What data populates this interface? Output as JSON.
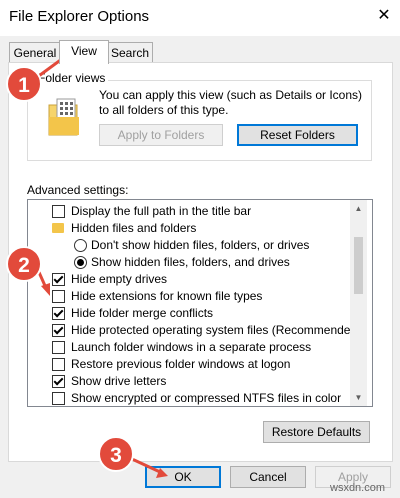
{
  "window": {
    "title": "File Explorer Options",
    "close_glyph": "✕"
  },
  "tabs": [
    {
      "label": "General"
    },
    {
      "label": "View"
    },
    {
      "label": "Search"
    }
  ],
  "folder_views": {
    "group_label": "Folder views",
    "icon": "folder-views-icon",
    "description": "You can apply this view (such as Details or Icons) to all folders of this type.",
    "apply_button": "Apply to Folders",
    "reset_button": "Reset Folders"
  },
  "advanced": {
    "label": "Advanced settings:",
    "items": [
      {
        "type": "checkbox",
        "checked": false,
        "label": "Display the full path in the title bar"
      },
      {
        "type": "folder",
        "label": "Hidden files and folders"
      },
      {
        "type": "radio",
        "checked": false,
        "label": "Don't show hidden files, folders, or drives"
      },
      {
        "type": "radio",
        "checked": true,
        "label": "Show hidden files, folders, and drives"
      },
      {
        "type": "checkbox",
        "checked": true,
        "label": "Hide empty drives"
      },
      {
        "type": "checkbox",
        "checked": false,
        "label": "Hide extensions for known file types"
      },
      {
        "type": "checkbox",
        "checked": true,
        "label": "Hide folder merge conflicts"
      },
      {
        "type": "checkbox",
        "checked": true,
        "label": "Hide protected operating system files (Recommended)"
      },
      {
        "type": "checkbox",
        "checked": false,
        "label": "Launch folder windows in a separate process"
      },
      {
        "type": "checkbox",
        "checked": false,
        "label": "Restore previous folder windows at logon"
      },
      {
        "type": "checkbox",
        "checked": true,
        "label": "Show drive letters"
      },
      {
        "type": "checkbox",
        "checked": false,
        "label": "Show encrypted or compressed NTFS files in color"
      }
    ],
    "restore_defaults": "Restore Defaults"
  },
  "footer": {
    "ok": "OK",
    "cancel": "Cancel",
    "apply": "Apply"
  },
  "annotations": {
    "badge_1": "1",
    "badge_2": "2",
    "badge_3": "3",
    "badge_color": "#e24a3b"
  },
  "watermark": "wsxdn.com"
}
